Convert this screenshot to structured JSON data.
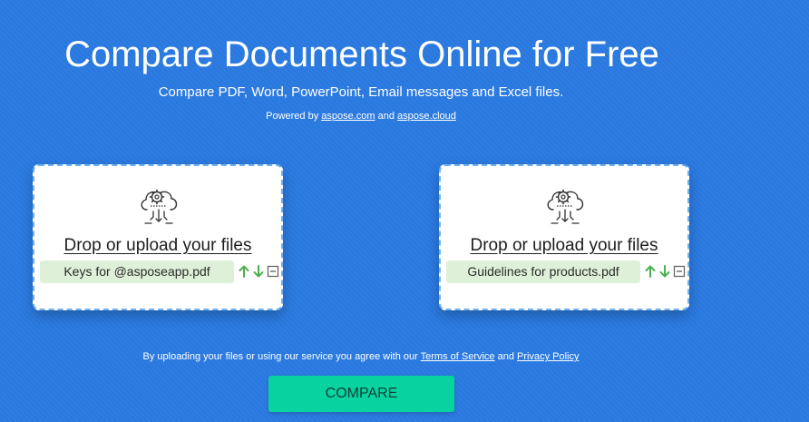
{
  "header": {
    "title": "Compare Documents Online for Free",
    "subtitle": "Compare PDF, Word, PowerPoint, Email messages and Excel files.",
    "powered_prefix": "Powered by ",
    "powered_link1": "aspose.com",
    "powered_and": " and ",
    "powered_link2": "aspose.cloud"
  },
  "uploads": [
    {
      "icon": "cloud-upload-gear-icon",
      "drop_label": "Drop or upload your files",
      "file_name": "Keys for @asposeapp.pdf",
      "actions": [
        "move-up-icon",
        "move-down-icon",
        "remove-icon"
      ]
    },
    {
      "icon": "cloud-upload-gear-icon",
      "drop_label": "Drop or upload your files",
      "file_name": "Guidelines for products.pdf",
      "actions": [
        "move-up-icon",
        "move-down-icon",
        "remove-icon"
      ]
    }
  ],
  "footer": {
    "terms_prefix": "By uploading your files or using our service you agree with our ",
    "terms_link": "Terms of Service",
    "terms_and": " and ",
    "privacy_link": "Privacy Policy",
    "compare_label": "COMPARE"
  },
  "colors": {
    "background": "#2a7ae2",
    "file_row": "#dff0d8",
    "action_green": "#4caf50",
    "compare_button": "#08d3a0"
  }
}
